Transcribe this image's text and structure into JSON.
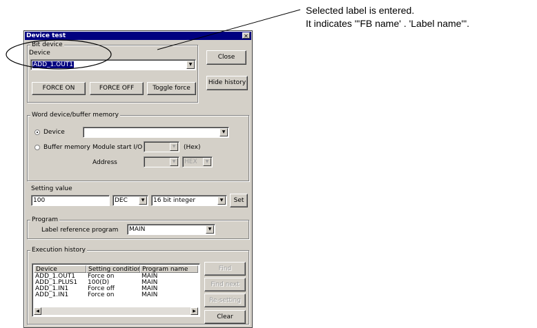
{
  "annotation": {
    "line1": "Selected label is entered.",
    "line2": "It indicates \"'FB name' . 'Label name'\"."
  },
  "window": {
    "title": "Device test",
    "close_glyph": "✕"
  },
  "bit_device": {
    "group_title": "Bit device",
    "device_label": "Device",
    "device_value": "ADD_1.OUT1",
    "force_on": "FORCE ON",
    "force_off": "FORCE OFF",
    "toggle_force": "Toggle force",
    "close": "Close",
    "hide_history": "Hide history"
  },
  "word_device": {
    "group_title": "Word device/buffer memory",
    "device_radio": "Device",
    "device_value": "",
    "buffer_radio": "Buffer memory",
    "module_start_label": "Module start I/O",
    "module_start_value": "",
    "hex_label": "(Hex)",
    "address_label": "Address",
    "address_value": "",
    "address_format": "HEX"
  },
  "setting": {
    "label": "Setting value",
    "value": "100",
    "format": "DEC",
    "data_type": "16 bit integer",
    "set_button": "Set"
  },
  "program": {
    "group_title": "Program",
    "label": "Label reference program",
    "value": "MAIN"
  },
  "history": {
    "group_title": "Execution history",
    "columns": [
      "Device",
      "Setting condition",
      "Program name"
    ],
    "rows": [
      [
        "ADD_1.OUT1",
        "Force on",
        "MAIN"
      ],
      [
        "ADD_1.PLUS1",
        "100(D)",
        "MAIN"
      ],
      [
        "ADD_1.IN1",
        "Force off",
        "MAIN"
      ],
      [
        "ADD_1.IN1",
        "Force on",
        "MAIN"
      ]
    ],
    "find": "Find",
    "find_next": "Find next",
    "re_setting": "Re-setting",
    "clear": "Clear"
  }
}
